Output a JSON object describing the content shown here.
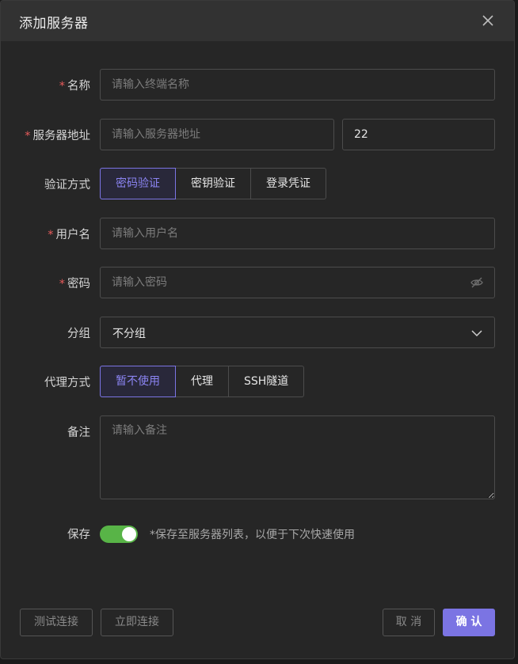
{
  "dialog": {
    "title": "添加服务器",
    "close_icon": "close-icon"
  },
  "form": {
    "required_mark": "*",
    "name": {
      "label": "名称",
      "placeholder": "请输入终端名称",
      "value": ""
    },
    "host": {
      "label": "服务器地址",
      "placeholder": "请输入服务器地址",
      "value": "",
      "port": "22"
    },
    "auth": {
      "label": "验证方式",
      "options": [
        "密码验证",
        "密钥验证",
        "登录凭证"
      ],
      "selected": "密码验证"
    },
    "username": {
      "label": "用户名",
      "placeholder": "请输入用户名",
      "value": ""
    },
    "password": {
      "label": "密码",
      "placeholder": "请输入密码",
      "value": "",
      "icon": "eye-slash-icon"
    },
    "group": {
      "label": "分组",
      "value": "不分组",
      "icon": "chevron-down-icon"
    },
    "proxy": {
      "label": "代理方式",
      "options": [
        "暂不使用",
        "代理",
        "SSH隧道"
      ],
      "selected": "暂不使用"
    },
    "note": {
      "label": "备注",
      "placeholder": "请输入备注",
      "value": ""
    },
    "save": {
      "label": "保存",
      "enabled": true,
      "hint": "*保存至服务器列表，以便于下次快速使用"
    }
  },
  "footer": {
    "test_label": "测试连接",
    "connect_label": "立即连接",
    "cancel_label": "取 消",
    "confirm_label": "确 认"
  },
  "colors": {
    "accent": "#7b74e3",
    "required": "#e85b5b",
    "toggle_on": "#58b447",
    "background": "#262626",
    "header": "#323232"
  }
}
